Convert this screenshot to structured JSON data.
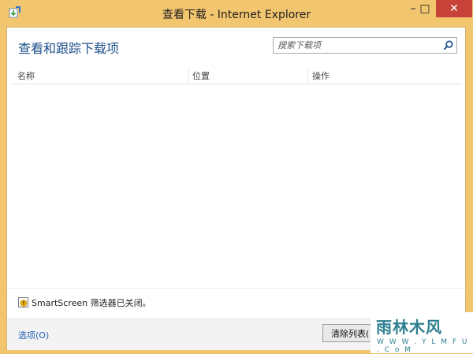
{
  "window": {
    "title": "查看下载 - Internet Explorer",
    "controls": {
      "minimize": "–",
      "maximize": "□",
      "close": "✕"
    }
  },
  "header": {
    "title": "查看和跟踪下载项",
    "search_placeholder": "搜索下载项"
  },
  "table": {
    "columns": [
      "名称",
      "位置",
      "操作"
    ]
  },
  "status": {
    "text": "SmartScreen 筛选器已关闭。"
  },
  "footer": {
    "options_label": "选项(O)",
    "clear_label": "清除列表("
  },
  "watermark": {
    "logo": "雨林木风",
    "url": "W W W . Y L M F U . C o M"
  },
  "colors": {
    "frame": "#f2c56f",
    "close": "#c7433a",
    "accent_text": "#1c4f8a",
    "link": "#1e5fb0"
  },
  "icons": [
    "ie-download-icon",
    "search-icon",
    "shield-warning-icon"
  ]
}
